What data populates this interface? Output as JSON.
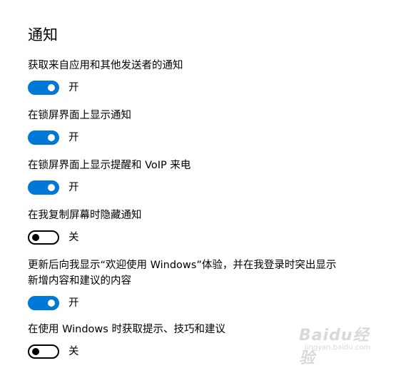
{
  "section": {
    "title": "通知"
  },
  "settings": [
    {
      "label": "获取来自应用和其他发送者的通知",
      "state_text": "开",
      "on": true
    },
    {
      "label": "在锁屏界面上显示通知",
      "state_text": "开",
      "on": true
    },
    {
      "label": "在锁屏界面上显示提醒和 VoIP 来电",
      "state_text": "开",
      "on": true
    },
    {
      "label": "在我复制屏幕时隐藏通知",
      "state_text": "关",
      "on": false
    },
    {
      "label": "更新后向我显示“欢迎使用 Windows”体验，并在我登录时突出显示\n新增内容和建议的内容",
      "state_text": "开",
      "on": true
    },
    {
      "label": "在使用 Windows 时获取提示、技巧和建议",
      "state_text": "关",
      "on": false
    }
  ],
  "colors": {
    "accent": "#0078d7",
    "text": "#000000",
    "background": "#ffffff"
  },
  "watermark": {
    "brand": "Baidu经验",
    "url": "jingyan.baidu.com"
  }
}
